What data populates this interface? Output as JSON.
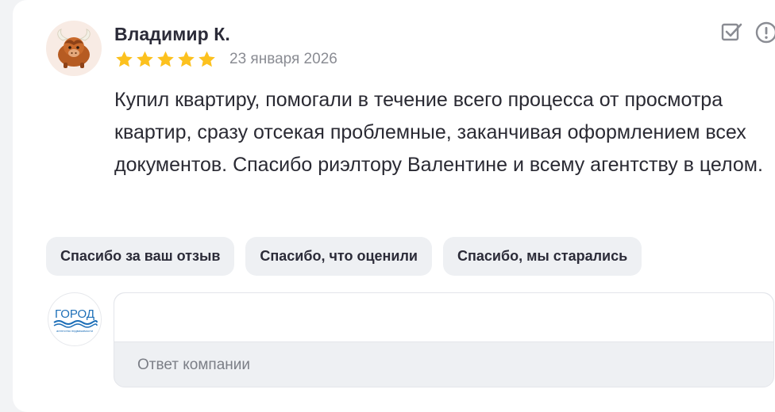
{
  "review": {
    "author": "Владимир К.",
    "rating": 5,
    "date": "23 января 2026",
    "text": "Купил квартиру, помогали в течение всего процесса от просмотра квартир, сразу отсекая проблемные, заканчивая оформлением всех документов. Спасибо риэлтору Валентине и всему агентству в целом.",
    "avatar_icon": "yak-avatar-icon"
  },
  "actions": {
    "mark_icon": "checkbox-check-icon",
    "report_icon": "exclamation-circle-icon"
  },
  "quick_replies": [
    "Спасибо за ваш отзыв",
    "Спасибо, что оценили",
    "Спасибо, мы старались"
  ],
  "company": {
    "logo_text": "ГОРОД",
    "logo_subtext": "агентство недвижимости"
  },
  "reply": {
    "input_value": "",
    "placeholder": "Ответ компании"
  },
  "colors": {
    "star": "#fcc11e",
    "icon": "#8a8c93",
    "chip_bg": "#eef0f3",
    "logo_blue": "#1d6fb8"
  }
}
